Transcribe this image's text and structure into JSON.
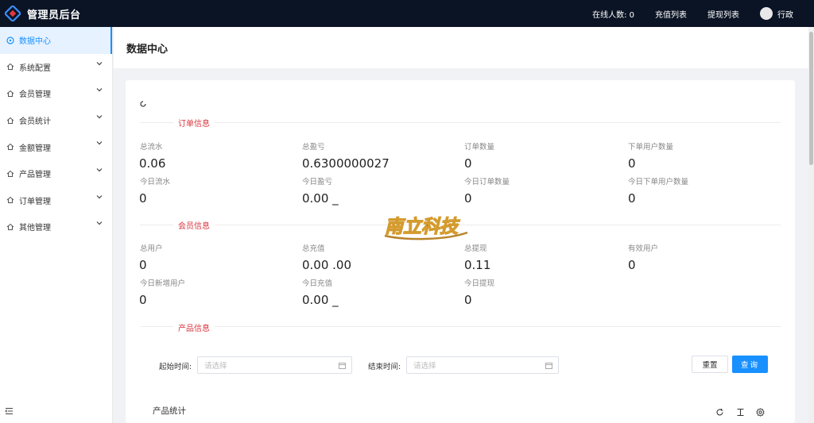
{
  "header": {
    "title": "管理员后台",
    "online_label": "在线人数: 0",
    "recharge_list": "充值列表",
    "withdraw_list": "提现列表",
    "user_name": "行政"
  },
  "sidebar": {
    "items": [
      {
        "label": "数据中心",
        "icon": "dashboard-icon"
      },
      {
        "label": "系统配置",
        "icon": "house-icon"
      },
      {
        "label": "会员管理",
        "icon": "house-icon"
      },
      {
        "label": "会员统计",
        "icon": "house-icon"
      },
      {
        "label": "金额管理",
        "icon": "house-icon"
      },
      {
        "label": "产品管理",
        "icon": "house-icon"
      },
      {
        "label": "订单管理",
        "icon": "house-icon"
      },
      {
        "label": "其他管理",
        "icon": "house-icon"
      }
    ]
  },
  "page": {
    "title": "数据中心"
  },
  "order_section": {
    "title": "订单信息",
    "stats": [
      {
        "label": "总流水",
        "value": "0.06"
      },
      {
        "label": "总盈亏",
        "value": "0.6300000027"
      },
      {
        "label": "订单数量",
        "value": "0"
      },
      {
        "label": "下单用户数量",
        "value": "0"
      },
      {
        "label": "今日流水",
        "value": "0"
      },
      {
        "label": "今日盈亏",
        "value": "0.00 _"
      },
      {
        "label": "今日订单数量",
        "value": "0"
      },
      {
        "label": "今日下单用户数量",
        "value": "0"
      }
    ]
  },
  "member_section": {
    "title": "会员信息",
    "stats": [
      {
        "label": "总用户",
        "value": "0"
      },
      {
        "label": "总充值",
        "value": "0.00 .00"
      },
      {
        "label": "总提现",
        "value": "0.11"
      },
      {
        "label": "有效用户",
        "value": "0"
      },
      {
        "label": "今日新增用户",
        "value": "0"
      },
      {
        "label": "今日充值",
        "value": "0.00 _"
      },
      {
        "label": "今日提现",
        "value": "0"
      }
    ]
  },
  "product_section": {
    "title": "产品信息",
    "start_label": "起始时间:",
    "end_label": "结束时间:",
    "placeholder": "请选择",
    "reset_label": "重置",
    "query_label": "查询",
    "stats_title": "产品统计"
  },
  "watermark_text": "南立科技",
  "colors": {
    "accent": "#1890ff",
    "header_bg": "#0b1425",
    "section_title": "#d9363e"
  }
}
